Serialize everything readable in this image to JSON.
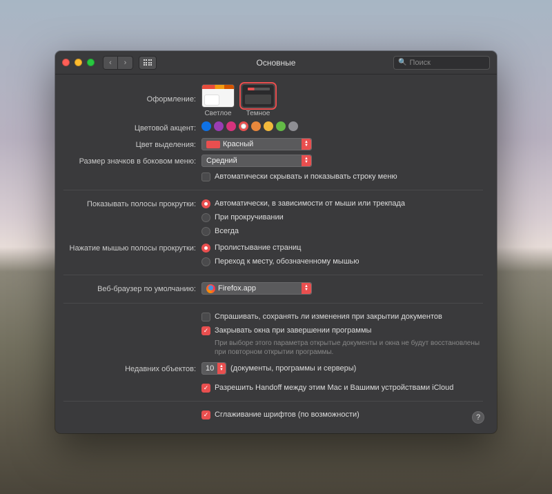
{
  "window_title": "Основные",
  "search_placeholder": "Поиск",
  "labels": {
    "appearance": "Оформление:",
    "accent": "Цветовой акцент:",
    "highlight": "Цвет выделения:",
    "sidebar_size": "Размер значков в боковом меню:",
    "scrollbars": "Показывать полосы прокрутки:",
    "scroll_click": "Нажатие мышью полосы прокрутки:",
    "default_browser": "Веб-браузер по умолчанию:",
    "recent_items": "Недавних объектов:"
  },
  "appearance": {
    "options": [
      "Светлое",
      "Темное"
    ],
    "selected": 1
  },
  "accent_colors": [
    {
      "hex": "#0f72e5",
      "selected": false
    },
    {
      "hex": "#9a3db3",
      "selected": false
    },
    {
      "hex": "#d6337c",
      "selected": false
    },
    {
      "hex": "#e94f4f",
      "selected": true
    },
    {
      "hex": "#e8873c",
      "selected": false
    },
    {
      "hex": "#f2b93b",
      "selected": false
    },
    {
      "hex": "#63ba46",
      "selected": false
    },
    {
      "hex": "#8e8e93",
      "selected": false
    }
  ],
  "highlight_value": "Красный",
  "sidebar_size_value": "Средний",
  "autohide_menubar": {
    "label": "Автоматически скрывать и показывать строку меню",
    "checked": false
  },
  "scrollbar_options": [
    {
      "label": "Автоматически, в зависимости от мыши или трекпада",
      "checked": true
    },
    {
      "label": "При прокручивании",
      "checked": false
    },
    {
      "label": "Всегда",
      "checked": false
    }
  ],
  "scroll_click_options": [
    {
      "label": "Пролистывание страниц",
      "checked": true
    },
    {
      "label": "Переход к месту, обозначенному мышью",
      "checked": false
    }
  ],
  "default_browser_value": "Firefox.app",
  "ask_save": {
    "label": "Спрашивать, сохранять ли изменения при закрытии документов",
    "checked": false
  },
  "close_windows": {
    "label": "Закрывать окна при завершении программы",
    "checked": true
  },
  "close_windows_help": "При выборе этого параметра открытые документы и окна не будут восстановлены при повторном открытии программы.",
  "recent_count": "10",
  "recent_suffix": "(документы, программы и серверы)",
  "handoff": {
    "label": "Разрешить Handoff между этим Mac и Вашими устройствами iCloud",
    "checked": true
  },
  "font_smoothing": {
    "label": "Сглаживание шрифтов (по возможности)",
    "checked": true
  }
}
